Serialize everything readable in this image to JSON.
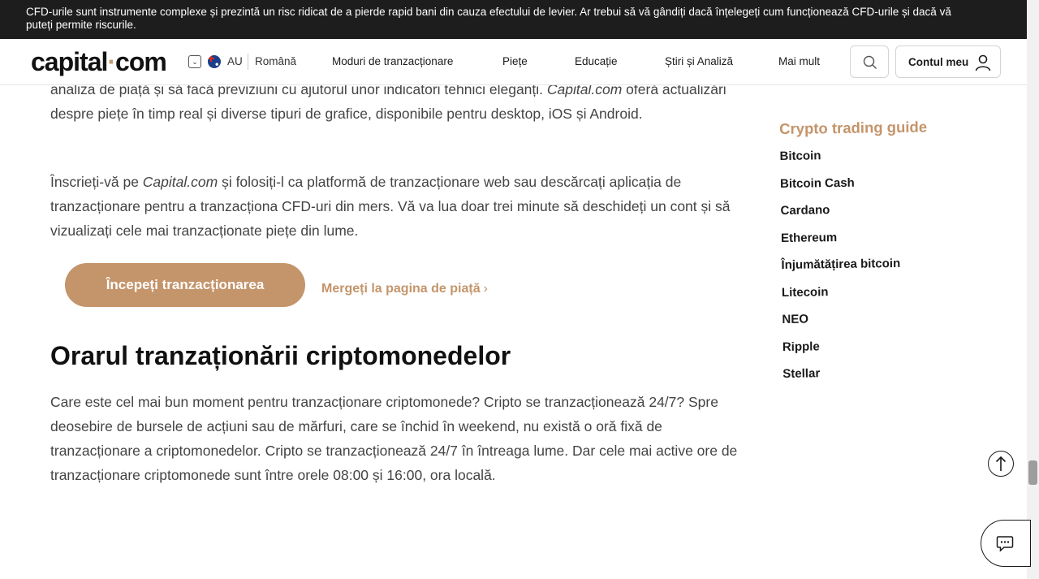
{
  "risk_banner": {
    "text": "CFD-urile sunt instrumente complexe și prezintă un risc ridicat de a pierde rapid bani din cauza efectului de levier. Ar trebui să vă gândiți dacă înțelegeți cum funcționează CFD-urile și dacă vă puteți permite riscurile."
  },
  "header": {
    "logo_text": "capital",
    "logo_dot": "·",
    "logo_suffix": "com",
    "region": "AU",
    "language": "Română",
    "nav": [
      {
        "label": "Moduri de tranzacționare"
      },
      {
        "label": "Piețe"
      },
      {
        "label": "Educație"
      },
      {
        "label": "Știri și Analiză"
      },
      {
        "label": "Mai mult"
      }
    ],
    "account_label": "Contul meu"
  },
  "article": {
    "p1_a": "analiza de piață și să facă previziuni cu ajutorul unor indicatori tehnici eleganți. ",
    "p1_brand": "Capital.com",
    "p1_b": " oferă actualizări despre piețe în timp real și diverse tipuri de grafice, disponibile pentru desktop, iOS și Android.",
    "p2_a": "Înscrieți-vă pe ",
    "p2_brand": "Capital.com",
    "p2_b": " și folosiți-l ca platformă de tranzacționare web sau descărcați aplicația de tranzacționare pentru a tranzacționa CFD-uri din mers. Vă va lua doar trei minute să deschideți un cont și să vizualizați cele mai tranzacționate piețe din lume.",
    "cta_label": "Începeți tranzacționarea",
    "market_link": "Mergeți la pagina de piață",
    "section_title": "Orarul tranzaționării criptomonedelor",
    "p3": "Care este cel mai bun moment pentru tranzacționare criptomonede? Cripto se tranzacționează 24/7? Spre deosebire de bursele de acțiuni sau de mărfuri, care se închid în weekend, nu există o oră fixă de tranzacționare a criptomonedelor. Cripto se tranzacționează 24/7 în întreaga lume. Dar cele mai active ore de tranzacționare criptomonede sunt între orele 08:00 și 16:00, ora locală."
  },
  "sidebar": {
    "title": "Crypto trading guide",
    "items": [
      {
        "label": "Bitcoin"
      },
      {
        "label": "Bitcoin Cash"
      },
      {
        "label": "Cardano"
      },
      {
        "label": "Ethereum"
      },
      {
        "label": "Înjumătățirea bitcoin"
      },
      {
        "label": "Litecoin"
      },
      {
        "label": "NEO"
      },
      {
        "label": "Ripple"
      },
      {
        "label": "Stellar"
      }
    ]
  },
  "colors": {
    "accent": "#c4946a",
    "banner_bg": "#1d1d1d",
    "text": "#444444"
  },
  "icons": {
    "search": "search-icon",
    "account": "user-icon",
    "scroll_top": "arrow-up-icon",
    "chat": "chat-icon"
  },
  "scroll_position": 0.82
}
